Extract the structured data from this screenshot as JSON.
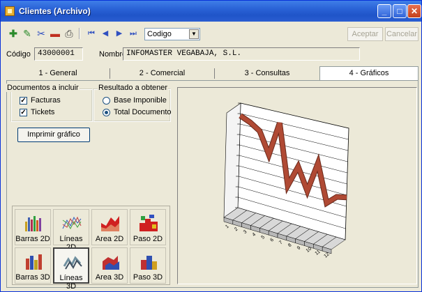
{
  "window": {
    "title": "Clientes (Archivo)"
  },
  "toolbar": {
    "icons": [
      "add-icon",
      "edit-icon",
      "tools-icon",
      "delete-icon",
      "print-icon",
      "first-icon",
      "previous-icon",
      "next-icon",
      "last-icon"
    ],
    "sort_select": "Codigo",
    "accept_label": "Aceptar",
    "cancel_label": "Cancelar"
  },
  "record": {
    "code_label": "Código",
    "code_value": "43000001",
    "name_label": "Nombre",
    "name_value": "INFOMASTER VEGABAJA, S.L."
  },
  "tabs": [
    {
      "label": "1 - General"
    },
    {
      "label": "2 - Comercial"
    },
    {
      "label": "3 - Consultas"
    },
    {
      "label": "4 - Gráficos",
      "active": true
    }
  ],
  "documents": {
    "title": "Documentos a incluir",
    "facturas": {
      "label": "Facturas",
      "checked": true
    },
    "tickets": {
      "label": "Tickets",
      "checked": true
    }
  },
  "result": {
    "title": "Resultado a obtener",
    "options": [
      {
        "label": "Base Imponible",
        "selected": false
      },
      {
        "label": "Total Documento",
        "selected": true
      }
    ]
  },
  "print_chart_label": "Imprimir gráfico",
  "chart_types": [
    {
      "label": "Barras 2D",
      "icon": "bar-2d-icon",
      "selected": false
    },
    {
      "label": "Líneas 2D",
      "icon": "line-2d-icon",
      "selected": false
    },
    {
      "label": "Area 2D",
      "icon": "area-2d-icon",
      "selected": false
    },
    {
      "label": "Paso 2D",
      "icon": "step-2d-icon",
      "selected": false
    },
    {
      "label": "Barras 3D",
      "icon": "bar-3d-icon",
      "selected": false
    },
    {
      "label": "Líneas 3D",
      "icon": "line-3d-icon",
      "selected": true
    },
    {
      "label": "Area 3D",
      "icon": "area-3d-icon",
      "selected": false
    },
    {
      "label": "Paso 3D",
      "icon": "step-3d-icon",
      "selected": false
    }
  ],
  "chart_data": {
    "type": "line",
    "style": "3d",
    "series_color": "#b04a34",
    "categories": [
      "1",
      "2",
      "3",
      "4",
      "5",
      "6",
      "7",
      "8",
      "9",
      "10",
      "11",
      "12"
    ],
    "values": [
      88,
      84,
      78,
      58,
      90,
      34,
      54,
      34,
      62,
      28,
      36,
      38
    ],
    "ylim": [
      0,
      100
    ],
    "grid": true
  }
}
